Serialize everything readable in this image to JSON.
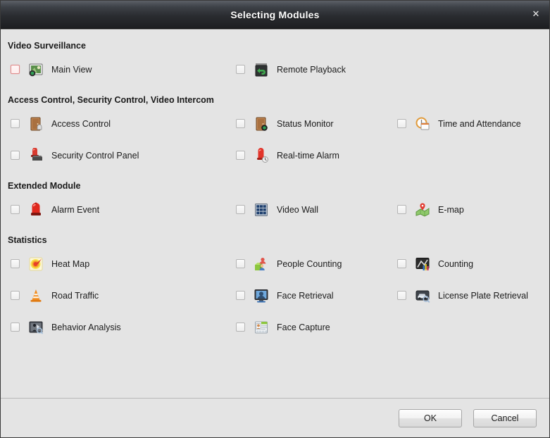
{
  "window": {
    "title": "Selecting Modules",
    "close_icon": "close-icon",
    "close_label": "✕"
  },
  "sections": [
    {
      "title": "Video Surveillance",
      "rows": [
        [
          {
            "label": "Main View",
            "icon": "main-view-icon",
            "checked": false,
            "highlighted": true
          },
          {
            "label": "Remote Playback",
            "icon": "remote-playback-icon",
            "checked": false,
            "highlighted": false
          }
        ]
      ]
    },
    {
      "title": "Access Control, Security Control, Video Intercom",
      "rows": [
        [
          {
            "label": "Access Control",
            "icon": "access-control-icon",
            "checked": false,
            "highlighted": false
          },
          {
            "label": "Status Monitor",
            "icon": "status-monitor-icon",
            "checked": false,
            "highlighted": false
          },
          {
            "label": "Time and Attendance",
            "icon": "time-attendance-icon",
            "checked": false,
            "highlighted": false
          }
        ],
        [
          {
            "label": "Security Control Panel",
            "icon": "security-control-panel-icon",
            "checked": false,
            "highlighted": false
          },
          {
            "label": "Real-time Alarm",
            "icon": "real-time-alarm-icon",
            "checked": false,
            "highlighted": false
          }
        ]
      ]
    },
    {
      "title": "Extended Module",
      "rows": [
        [
          {
            "label": "Alarm Event",
            "icon": "alarm-event-icon",
            "checked": false,
            "highlighted": false
          },
          {
            "label": "Video Wall",
            "icon": "video-wall-icon",
            "checked": false,
            "highlighted": false
          },
          {
            "label": "E-map",
            "icon": "emap-icon",
            "checked": false,
            "highlighted": false
          }
        ]
      ]
    },
    {
      "title": "Statistics",
      "rows": [
        [
          {
            "label": "Heat Map",
            "icon": "heat-map-icon",
            "checked": false,
            "highlighted": false
          },
          {
            "label": "People Counting",
            "icon": "people-counting-icon",
            "checked": false,
            "highlighted": false
          },
          {
            "label": "Counting",
            "icon": "counting-icon",
            "checked": false,
            "highlighted": false
          }
        ],
        [
          {
            "label": "Road Traffic",
            "icon": "road-traffic-icon",
            "checked": false,
            "highlighted": false
          },
          {
            "label": "Face Retrieval",
            "icon": "face-retrieval-icon",
            "checked": false,
            "highlighted": false
          },
          {
            "label": "License Plate Retrieval",
            "icon": "license-plate-retrieval-icon",
            "checked": false,
            "highlighted": false
          }
        ],
        [
          {
            "label": "Behavior Analysis",
            "icon": "behavior-analysis-icon",
            "checked": false,
            "highlighted": false
          },
          {
            "label": "Face Capture",
            "icon": "face-capture-icon",
            "checked": false,
            "highlighted": false
          }
        ]
      ]
    }
  ],
  "footer": {
    "ok_label": "OK",
    "cancel_label": "Cancel"
  },
  "colors": {
    "titlebar_dark": "#1d1e21",
    "body_bg": "#e4e4e4",
    "highlight_border": "#e08b8b",
    "text": "#1b1b1b"
  }
}
